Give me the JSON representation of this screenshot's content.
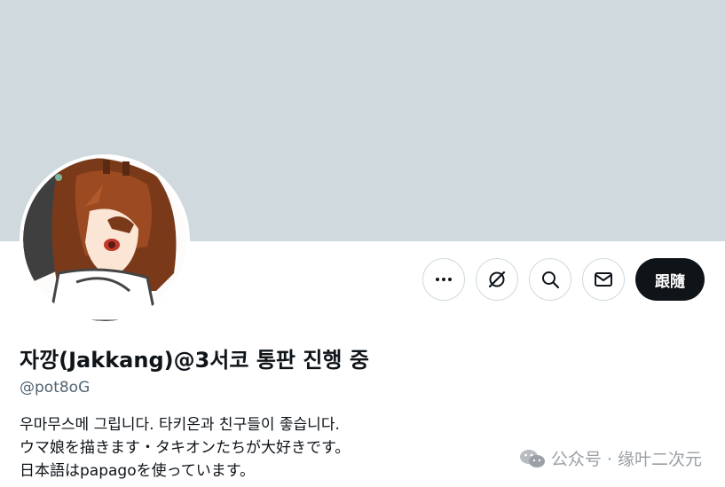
{
  "profile": {
    "display_name": "자깡(Jakkang)@3서코 통판 진행 중",
    "handle": "@pot8oG",
    "bio": [
      "우마무스메 그립니다. 타키온과 친구들이 좋습니다.",
      "ウマ娘を描きます・タキオンたちが大好きです。",
      "日本語はpapagoを使っています。"
    ],
    "banner_color": "#cfd9de"
  },
  "actions": {
    "more_icon": "more-horizontal-icon",
    "grok_icon": "grok-icon",
    "search_icon": "search-icon",
    "message_icon": "mail-icon",
    "follow_label": "跟隨"
  },
  "watermark": {
    "text": "公众号 · 缘叶二次元",
    "icon": "wechat-icon"
  }
}
